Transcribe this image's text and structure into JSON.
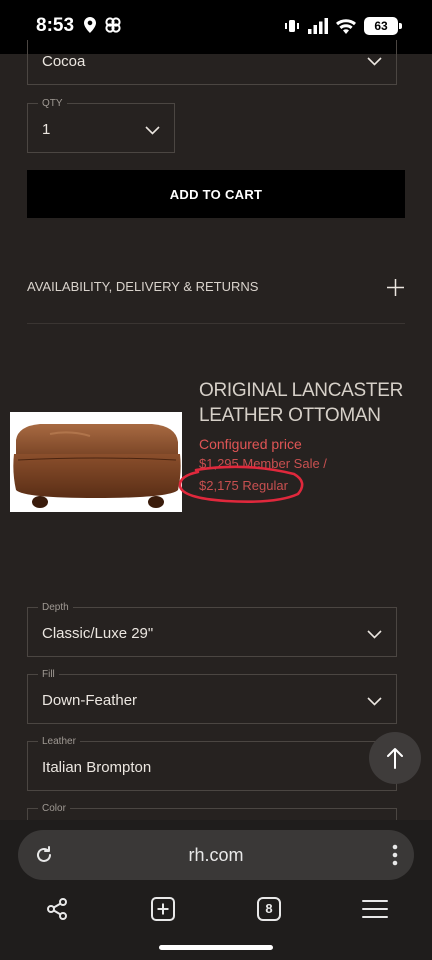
{
  "status_bar": {
    "time": "8:53",
    "battery": "63"
  },
  "color_select": {
    "value": "Cocoa"
  },
  "qty": {
    "label": "QTY",
    "value": "1"
  },
  "cart": {
    "button_label": "ADD TO CART"
  },
  "availability": {
    "label": "AVAILABILITY, DELIVERY & RETURNS"
  },
  "product": {
    "title_line1": "ORIGINAL LANCASTER",
    "title_line2": "LEATHER OTTOMAN",
    "configured_label": "Configured price",
    "member_price": "$1,295 Member Sale /",
    "regular_price": "$2,175 Regular"
  },
  "options": {
    "depth": {
      "label": "Depth",
      "value": "Classic/Luxe 29\""
    },
    "fill": {
      "label": "Fill",
      "value": "Down-Feather"
    },
    "leather": {
      "label": "Leather",
      "value": "Italian Brompton"
    },
    "color": {
      "label": "Color"
    }
  },
  "browser": {
    "url": "rh.com",
    "tab_count": "8"
  },
  "colors": {
    "background": "#262220",
    "sale_red": "#e05555",
    "annotation_red": "#e0283c"
  }
}
